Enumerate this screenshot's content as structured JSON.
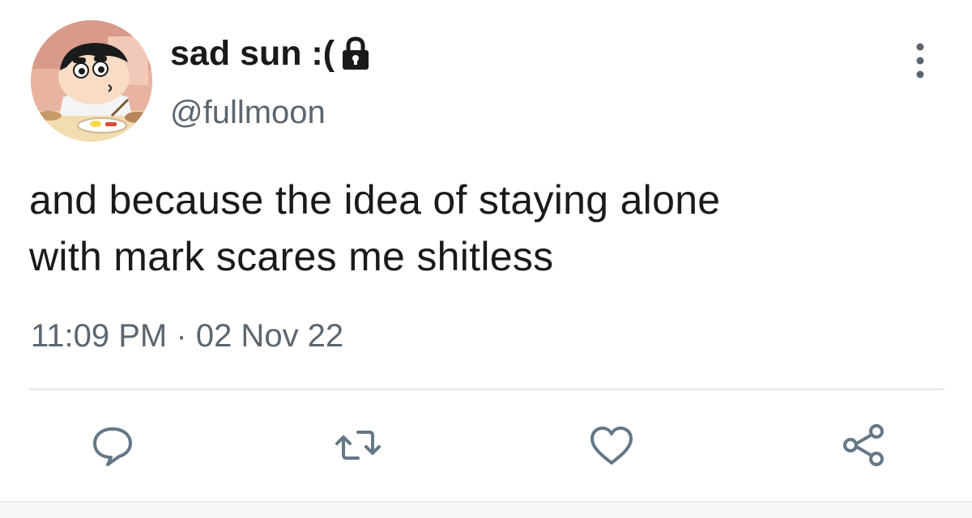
{
  "profile": {
    "display_name": "sad sun :(",
    "handle": "@fullmoon",
    "avatar_icon": "cartoon-boy-avatar",
    "locked_icon": "lock-icon"
  },
  "tweet": {
    "text_line1": "and because the idea of staying alone",
    "text_line2": "with mark scares me shitless",
    "time": "11:09 PM",
    "separator": "·",
    "date": "02 Nov 22"
  },
  "actions": [
    {
      "icon": "reply-icon"
    },
    {
      "icon": "retweet-icon"
    },
    {
      "icon": "like-icon"
    },
    {
      "icon": "share-icon"
    }
  ],
  "colors": {
    "text": "#1a1a1a",
    "secondary": "#5b6670",
    "divider": "#e4e8ec",
    "icon": "#657786"
  }
}
